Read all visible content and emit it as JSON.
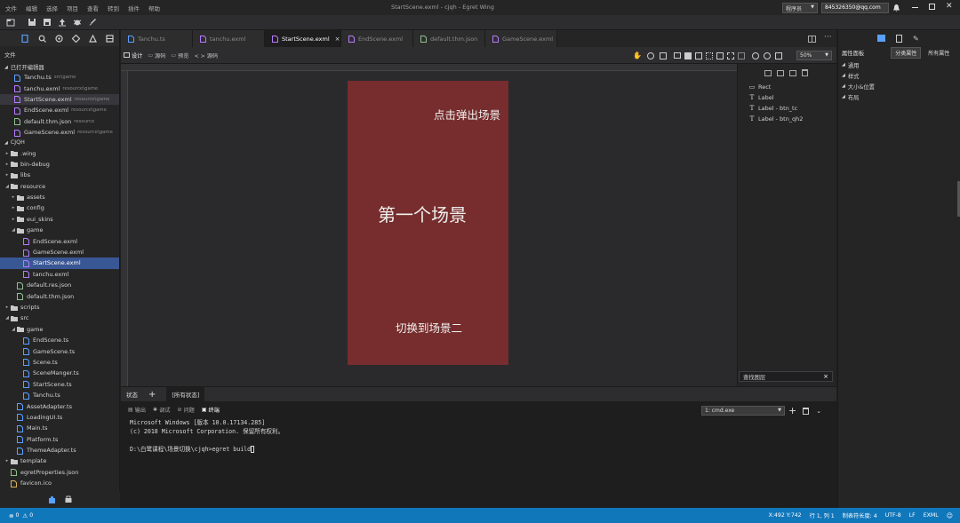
{
  "titlebar": {
    "menu": [
      "文件",
      "编辑",
      "选择",
      "项目",
      "查看",
      "转到",
      "插件",
      "帮助"
    ],
    "window_title": "StartScene.exml - cjqh - Egret Wing",
    "user_select": "程序员",
    "email": "845326350@qq.com"
  },
  "leftpanel": {
    "title": "文件",
    "open_editors_header": "已打开编辑器",
    "open_editors": [
      {
        "name": "Tanchu.ts",
        "path": "src\\game",
        "icon": "ts"
      },
      {
        "name": "tanchu.exml",
        "path": "resource\\game",
        "icon": "exml"
      },
      {
        "name": "StartScene.exml",
        "path": "resource\\game",
        "icon": "exml"
      },
      {
        "name": "EndScene.exml",
        "path": "resource\\game",
        "icon": "exml"
      },
      {
        "name": "default.thm.json",
        "path": "resource",
        "icon": "json"
      },
      {
        "name": "GameScene.exml",
        "path": "resource\\game",
        "icon": "exml"
      }
    ],
    "project_header": "CJQH",
    "tree": [
      {
        "name": ".wing",
        "type": "folder",
        "level": 1,
        "open": false
      },
      {
        "name": "bin-debug",
        "type": "folder",
        "level": 1,
        "open": false
      },
      {
        "name": "libs",
        "type": "folder",
        "level": 1,
        "open": false
      },
      {
        "name": "resource",
        "type": "folder",
        "level": 1,
        "open": true
      },
      {
        "name": "assets",
        "type": "folder",
        "level": 2,
        "open": false
      },
      {
        "name": "config",
        "type": "folder",
        "level": 2,
        "open": false
      },
      {
        "name": "eui_skins",
        "type": "folder",
        "level": 2,
        "open": false
      },
      {
        "name": "game",
        "type": "folder",
        "level": 2,
        "open": true
      },
      {
        "name": "EndScene.exml",
        "type": "exml",
        "level": 3
      },
      {
        "name": "GameScene.exml",
        "type": "exml",
        "level": 3
      },
      {
        "name": "StartScene.exml",
        "type": "exml",
        "level": 3,
        "selected": true
      },
      {
        "name": "tanchu.exml",
        "type": "exml",
        "level": 3
      },
      {
        "name": "default.res.json",
        "type": "json",
        "level": 2
      },
      {
        "name": "default.thm.json",
        "type": "json",
        "level": 2
      },
      {
        "name": "scripts",
        "type": "folder",
        "level": 1,
        "open": false
      },
      {
        "name": "src",
        "type": "folder",
        "level": 1,
        "open": true
      },
      {
        "name": "game",
        "type": "folder",
        "level": 2,
        "open": true
      },
      {
        "name": "EndScene.ts",
        "type": "ts",
        "level": 3
      },
      {
        "name": "GameScene.ts",
        "type": "ts",
        "level": 3
      },
      {
        "name": "Scene.ts",
        "type": "ts",
        "level": 3
      },
      {
        "name": "SceneManger.ts",
        "type": "ts",
        "level": 3
      },
      {
        "name": "StartScene.ts",
        "type": "ts",
        "level": 3
      },
      {
        "name": "Tanchu.ts",
        "type": "ts",
        "level": 3
      },
      {
        "name": "AssetAdapter.ts",
        "type": "ts",
        "level": 2
      },
      {
        "name": "LoadingUI.ts",
        "type": "ts",
        "level": 2
      },
      {
        "name": "Main.ts",
        "type": "ts",
        "level": 2
      },
      {
        "name": "Platform.ts",
        "type": "ts",
        "level": 2
      },
      {
        "name": "ThemeAdapter.ts",
        "type": "ts",
        "level": 2
      },
      {
        "name": "template",
        "type": "folder",
        "level": 1,
        "open": false
      },
      {
        "name": "egretProperties.json",
        "type": "json",
        "level": 1
      },
      {
        "name": "favicon.ico",
        "type": "ico",
        "level": 1
      }
    ]
  },
  "editor": {
    "tabs": [
      {
        "label": "Tanchu.ts",
        "icon": "ts",
        "active": false
      },
      {
        "label": "tanchu.exml",
        "icon": "exml",
        "active": false
      },
      {
        "label": "StartScene.exml",
        "icon": "exml",
        "active": true
      },
      {
        "label": "EndScene.exml",
        "icon": "exml",
        "active": false
      },
      {
        "label": "default.thm.json",
        "icon": "json",
        "active": false
      },
      {
        "label": "GameScene.exml",
        "icon": "exml",
        "active": false
      }
    ],
    "close_glyph": "×",
    "modes": [
      "设计",
      "源码",
      "预览",
      "< > 源码"
    ],
    "zoom": "50%"
  },
  "scene": {
    "top_label": "点击弹出场景",
    "center_label": "第一个场景",
    "bottom_label": "切换到场景二",
    "bg_color": "#772d2d"
  },
  "outline": {
    "items": [
      {
        "label": "Rect",
        "icon": "rect-icon"
      },
      {
        "label": "Label",
        "icon": "text-icon"
      },
      {
        "label": "Label - btn_tc",
        "icon": "text-icon"
      },
      {
        "label": "Label - btn_qh2",
        "icon": "text-icon"
      }
    ],
    "find_placeholder": "查找图层",
    "find_close": "×"
  },
  "statebar": {
    "label": "状态",
    "add": "+",
    "all_states": "[所有状态]"
  },
  "terminal": {
    "tabs": [
      "输出",
      "调试",
      "问题",
      "终端"
    ],
    "active_tab": "终端",
    "shell": "1: cmd.exe",
    "lines": [
      "Microsoft Windows [版本 10.0.17134.285]",
      "(c) 2018 Microsoft Corporation. 保留所有权利。",
      "",
      "D:\\白鹭课程\\场景切换\\cjqh>egret build"
    ]
  },
  "rightpanel": {
    "title": "属性面板",
    "btn_category": "分类属性",
    "btn_all": "所有属性",
    "sections": [
      "通用",
      "样式",
      "大小&位置",
      "布局"
    ]
  },
  "statusbar": {
    "errors": "0",
    "warnings": "0",
    "coords": "X:492 Y:742",
    "cursor": "行 1, 列 1",
    "tab_size": "制表符长度: 4",
    "encoding": "UTF-8",
    "eol": "LF",
    "language": "EXML"
  },
  "colors": {
    "accent_status": "#1177bb",
    "selected_tree": "#3a5795"
  }
}
